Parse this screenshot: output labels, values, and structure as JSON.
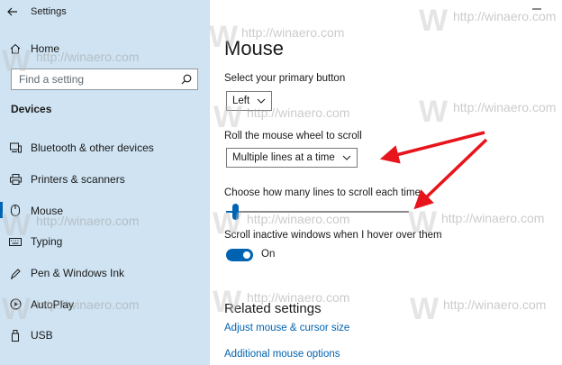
{
  "window": {
    "app_title": "Settings",
    "back_icon": "back-arrow-icon",
    "minimize_icon": "minimize-icon"
  },
  "sidebar": {
    "home_label": "Home",
    "search": {
      "placeholder": "Find a setting"
    },
    "section_heading": "Devices",
    "items": [
      {
        "label": "Bluetooth & other devices",
        "icon": "bluetooth-devices-icon"
      },
      {
        "label": "Printers & scanners",
        "icon": "printer-icon"
      },
      {
        "label": "Mouse",
        "icon": "mouse-icon",
        "selected": true
      },
      {
        "label": "Typing",
        "icon": "keyboard-icon"
      },
      {
        "label": "Pen & Windows Ink",
        "icon": "pen-icon"
      },
      {
        "label": "AutoPlay",
        "icon": "autoplay-icon"
      },
      {
        "label": "USB",
        "icon": "usb-icon"
      }
    ]
  },
  "main": {
    "title": "Mouse",
    "primary_button": {
      "label": "Select your primary button",
      "value": "Left"
    },
    "wheel_scroll": {
      "label": "Roll the mouse wheel to scroll",
      "value": "Multiple lines at a time"
    },
    "lines_slider": {
      "label": "Choose how many lines to scroll each time",
      "value": 3,
      "min": 1,
      "max": 100
    },
    "inactive_scroll": {
      "label": "Scroll inactive windows when I hover over them",
      "state": "On"
    },
    "related": {
      "heading": "Related settings",
      "links": [
        "Adjust mouse & cursor size",
        "Additional mouse options"
      ]
    }
  },
  "watermark": {
    "text": "http://winaero.com",
    "letter": "W"
  },
  "colors": {
    "sidebar_bg": "#cfe3f2",
    "accent": "#0063b1",
    "arrow": "#e8141c"
  }
}
